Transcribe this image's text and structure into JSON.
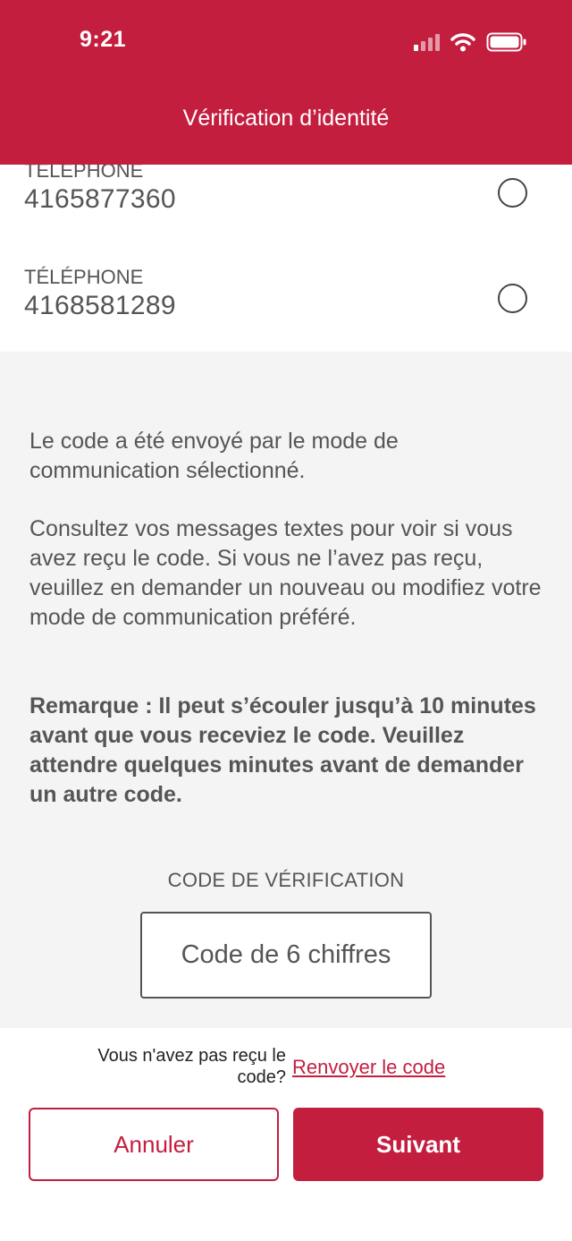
{
  "status_bar": {
    "time": "9:21"
  },
  "header": {
    "title": "Vérification d’identité"
  },
  "phone_options": [
    {
      "type": "TÉLÉPHONE",
      "number": "4165877360"
    },
    {
      "type": "TÉLÉPHONE",
      "number": "4168581289"
    }
  ],
  "info": {
    "sent_text": "Le code a été envoyé par le mode de communication sélectionné.",
    "instructions_text": "Consultez vos messages textes pour voir si vous avez reçu le code. Si vous ne l’avez pas reçu, veuillez en demander un nouveau ou modifiez votre mode de communication préféré.",
    "note_text": "Remarque : Il peut s’écouler jusqu’à 10 minutes avant que vous receviez le code. Veuillez attendre quelques minutes avant de demander un autre code."
  },
  "verification": {
    "label": "CODE DE VÉRIFICATION",
    "placeholder": "Code de 6 chiffres",
    "value": ""
  },
  "resend": {
    "question": "Vous n'avez pas reçu le code?",
    "link_label": "Renvoyer le code"
  },
  "actions": {
    "cancel_label": "Annuler",
    "next_label": "Suivant"
  },
  "colors": {
    "brand_red": "#c41e3f",
    "text_gray": "#555555",
    "panel_gray": "#f4f4f4"
  },
  "icons": [
    "signal-icon",
    "wifi-icon",
    "battery-icon",
    "radio-button"
  ]
}
